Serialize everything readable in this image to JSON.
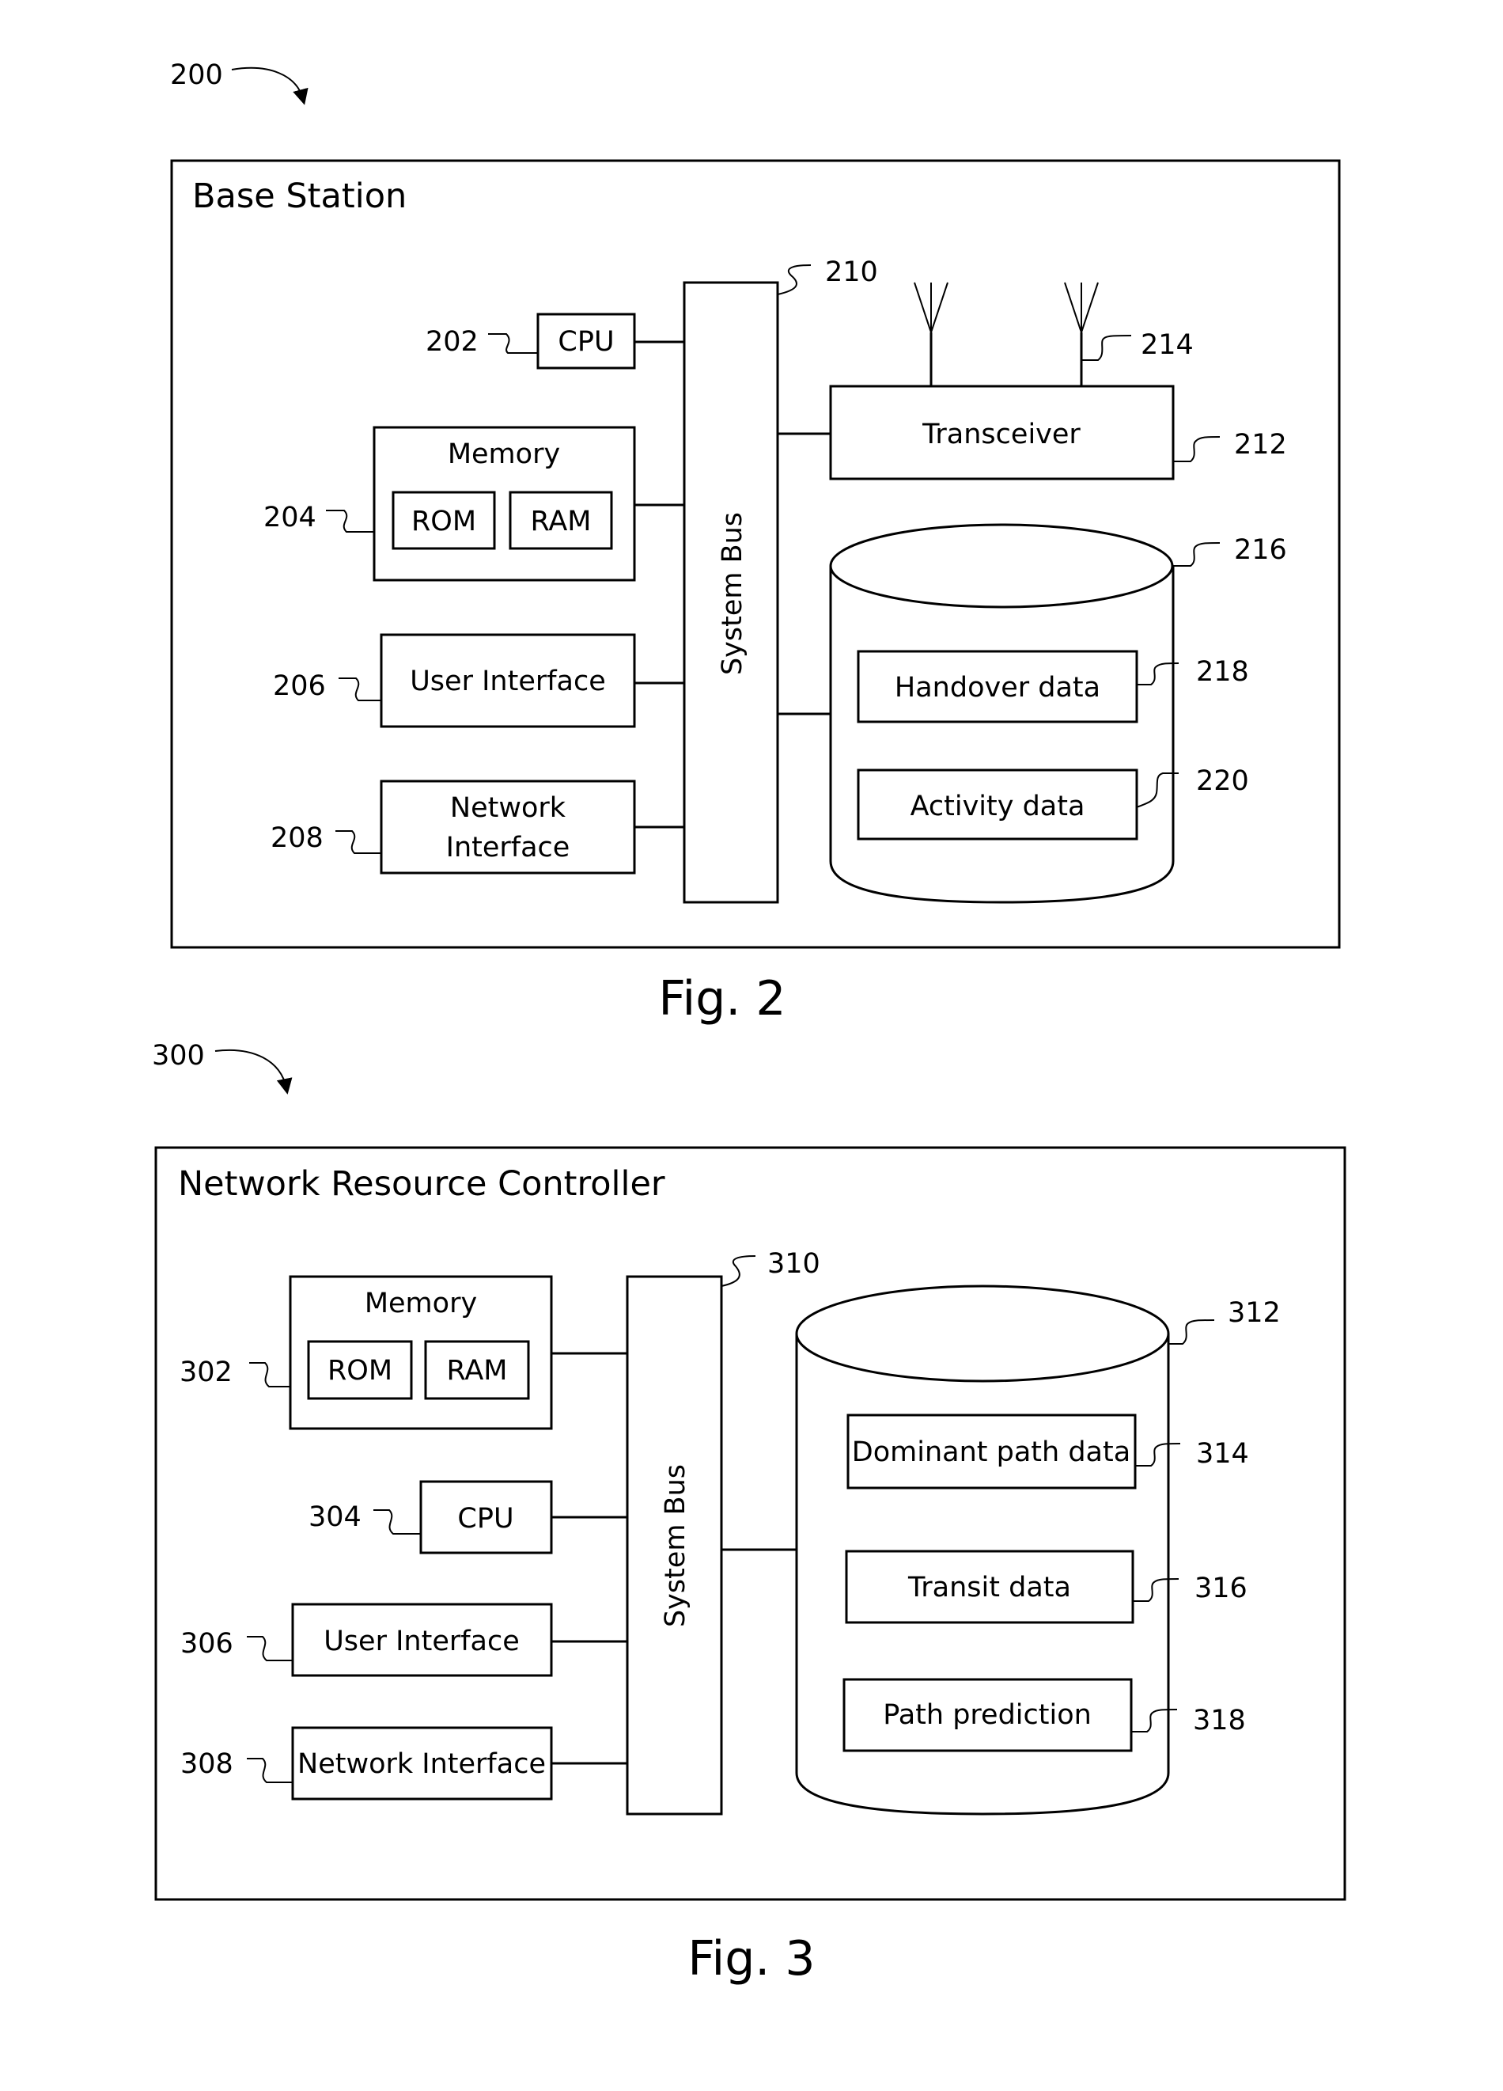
{
  "fig2": {
    "ref": "200",
    "title": "Base Station",
    "caption": "Fig. 2",
    "cpu": {
      "ref": "202",
      "label": "CPU"
    },
    "memory": {
      "ref": "204",
      "label": "Memory",
      "rom": "ROM",
      "ram": "RAM"
    },
    "user_interface": {
      "ref": "206",
      "label": "User Interface"
    },
    "network_interface": {
      "ref": "208",
      "label_line1": "Network",
      "label_line2": "Interface"
    },
    "system_bus": {
      "ref": "210",
      "label": "System Bus"
    },
    "transceiver": {
      "ref": "212",
      "label": "Transceiver"
    },
    "antennas": {
      "ref": "214"
    },
    "storage": {
      "ref": "216"
    },
    "handover_data": {
      "ref": "218",
      "label": "Handover data"
    },
    "activity_data": {
      "ref": "220",
      "label": "Activity data"
    }
  },
  "fig3": {
    "ref": "300",
    "title": "Network Resource Controller",
    "caption": "Fig. 3",
    "memory": {
      "ref": "302",
      "label": "Memory",
      "rom": "ROM",
      "ram": "RAM"
    },
    "cpu": {
      "ref": "304",
      "label": "CPU"
    },
    "user_interface": {
      "ref": "306",
      "label": "User Interface"
    },
    "network_interface": {
      "ref": "308",
      "label": "Network Interface"
    },
    "system_bus": {
      "ref": "310",
      "label": "System Bus"
    },
    "storage": {
      "ref": "312"
    },
    "dominant_path_data": {
      "ref": "314",
      "label": "Dominant path data"
    },
    "transit_data": {
      "ref": "316",
      "label": "Transit data"
    },
    "path_prediction": {
      "ref": "318",
      "label": "Path prediction"
    }
  }
}
